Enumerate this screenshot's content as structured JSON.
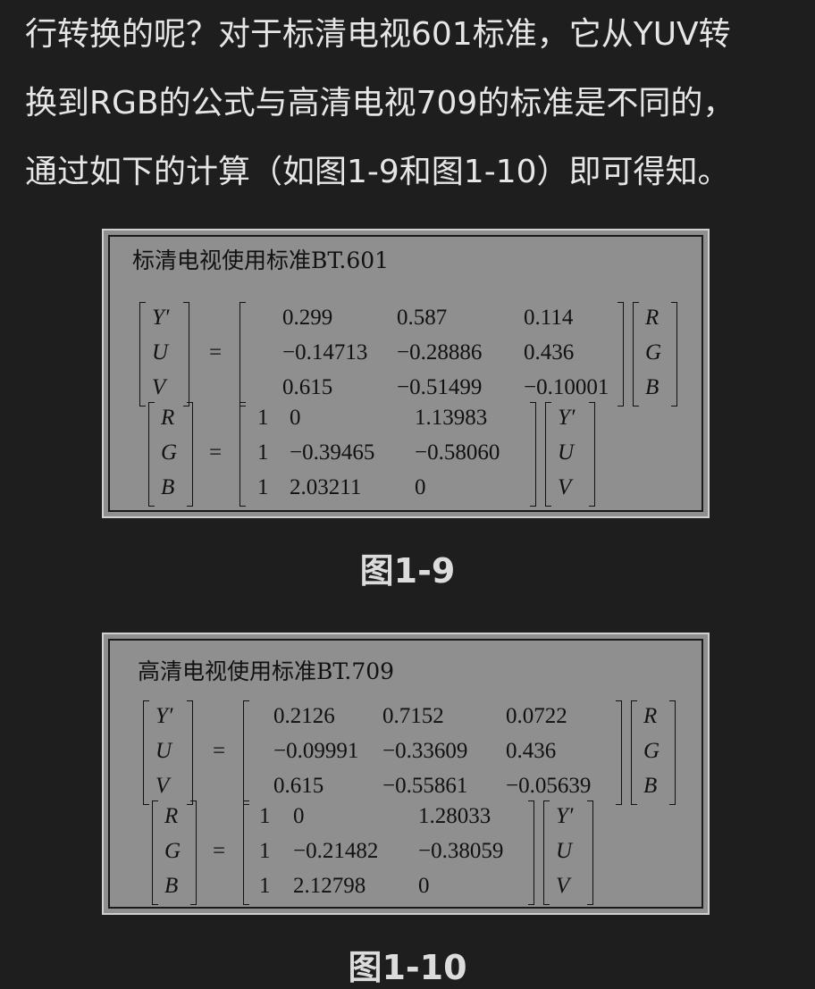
{
  "paragraph": {
    "lines": [
      "行转换的呢？对于标清电视601标准，它从YUV转",
      "换到RGB的公式与高清电视709的标准是不同的，",
      "通过如下的计算（如图1-9和图1-10）即可得知。"
    ]
  },
  "figures": [
    {
      "title": "标清电视使用标准BT.601",
      "caption": "图1-9",
      "eq1": {
        "lhs": [
          "Y′",
          "U",
          "V"
        ],
        "eq": "=",
        "matrix": [
          [
            "0.299",
            "0.587",
            "0.114"
          ],
          [
            "−0.14713",
            "−0.28886",
            "0.436"
          ],
          [
            "0.615",
            "−0.51499",
            "−0.10001"
          ]
        ],
        "rhs": [
          "R",
          "G",
          "B"
        ]
      },
      "eq2": {
        "lhs": [
          "R",
          "G",
          "B"
        ],
        "eq": "=",
        "matrix": [
          [
            "1",
            "0",
            "1.13983"
          ],
          [
            "1",
            "−0.39465",
            "−0.58060"
          ],
          [
            "1",
            "2.03211",
            "0"
          ]
        ],
        "rhs": [
          "Y′",
          "U",
          "V"
        ]
      }
    },
    {
      "title": "高清电视使用标准BT.709",
      "caption": "图1-10",
      "eq1": {
        "lhs": [
          "Y′",
          "U",
          "V"
        ],
        "eq": "=",
        "matrix": [
          [
            "0.2126",
            "0.7152",
            "0.0722"
          ],
          [
            "−0.09991",
            "−0.33609",
            "0.436"
          ],
          [
            "0.615",
            "−0.55861",
            "−0.05639"
          ]
        ],
        "rhs": [
          "R",
          "G",
          "B"
        ]
      },
      "eq2": {
        "lhs": [
          "R",
          "G",
          "B"
        ],
        "eq": "=",
        "matrix": [
          [
            "1",
            "0",
            "1.28033"
          ],
          [
            "1",
            "−0.21482",
            "−0.38059"
          ],
          [
            "1",
            "2.12798",
            "0"
          ]
        ],
        "rhs": [
          "Y′",
          "U",
          "V"
        ]
      }
    }
  ]
}
